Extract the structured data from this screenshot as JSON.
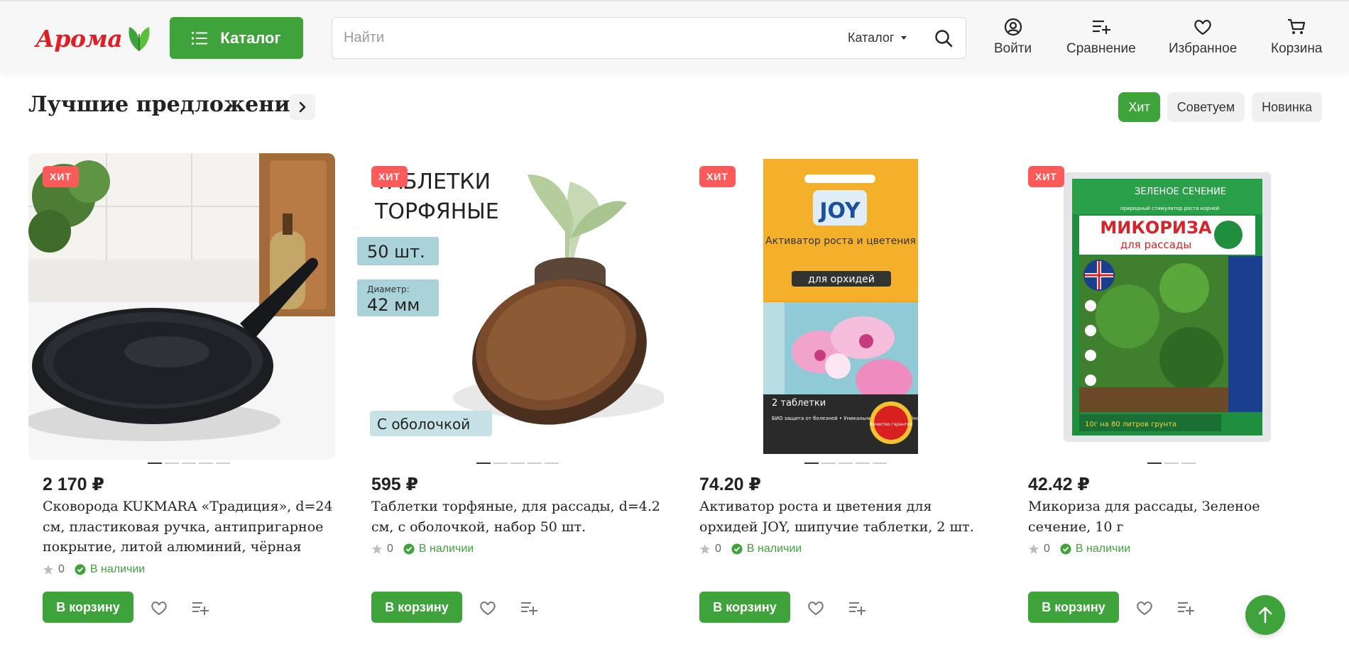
{
  "header": {
    "logo_text": "Арома",
    "catalog_label": "Каталог",
    "search": {
      "placeholder": "Найти",
      "scope_label": "Каталог"
    },
    "actions": {
      "login": "Войти",
      "compare": "Сравнение",
      "favorites": "Избранное",
      "cart": "Корзина"
    }
  },
  "section": {
    "title": "Лучшие предложения",
    "tabs": [
      {
        "label": "Хит",
        "active": true
      },
      {
        "label": "Советуем",
        "active": false
      },
      {
        "label": "Новинка",
        "active": false
      }
    ]
  },
  "products": [
    {
      "badge": "ХИТ",
      "price": "2 170 ₽",
      "name": "Сковорода KUKMARA «Традиция», d=24 см, пластиковая ручка, антипригарное покрытие, литой алюминий, чёрная",
      "rating": "0",
      "stock": "В наличии",
      "cart_label": "В корзину",
      "image_dots": 5,
      "image_dot_active": 1
    },
    {
      "badge": "ХИТ",
      "price": "595 ₽",
      "name": "Таблетки торфяные, для рассады, d=4.2 см, с оболочкой, набор 50 шт.",
      "rating": "0",
      "stock": "В наличии",
      "cart_label": "В корзину",
      "image_dots": 5,
      "image_dot_active": 1,
      "image_text": {
        "title_line1": "ТАБЛЕТКИ",
        "title_line2": "ТОРФЯНЫЕ",
        "count": "50 шт.",
        "diameter_label": "Диаметр:",
        "diameter_value": "42 мм",
        "shell": "С оболочкой"
      }
    },
    {
      "badge": "ХИТ",
      "price": "74.20 ₽",
      "name": "Активатор роста и цветения для орхидей JOY, шипучие таблетки, 2 шт.",
      "rating": "0",
      "stock": "В наличии",
      "cart_label": "В корзину",
      "image_dots": 5,
      "image_dot_active": 1,
      "image_text": {
        "brand": "JOY",
        "title": "Активатор роста и цветения",
        "subtitle": "для орхидей",
        "tablets": "2 таблетки",
        "quality": "Качество гарантия",
        "bullets": "БИО защита от болезней • Уникальный состав • Удобная форма: шипучие таблетки"
      }
    },
    {
      "badge": "ХИТ",
      "price": "42.42 ₽",
      "name": "Микориза для рассады, Зеленое сечение, 10 г",
      "rating": "0",
      "stock": "В наличии",
      "cart_label": "В корзину",
      "image_dots": 3,
      "image_dot_active": 1,
      "image_text": {
        "brand": "ЗЕЛЕНОЕ СЕЧЕНИЕ",
        "tagline": "природный стимулятор роста корней",
        "title": "МИКОРИЗА",
        "subtitle": "для рассады",
        "amount": "10г на 80 литров грунта"
      }
    }
  ],
  "colors": {
    "brand_green": "#3fa33c",
    "badge_red": "#ff5a5a",
    "logo_red": "#e01e26"
  }
}
